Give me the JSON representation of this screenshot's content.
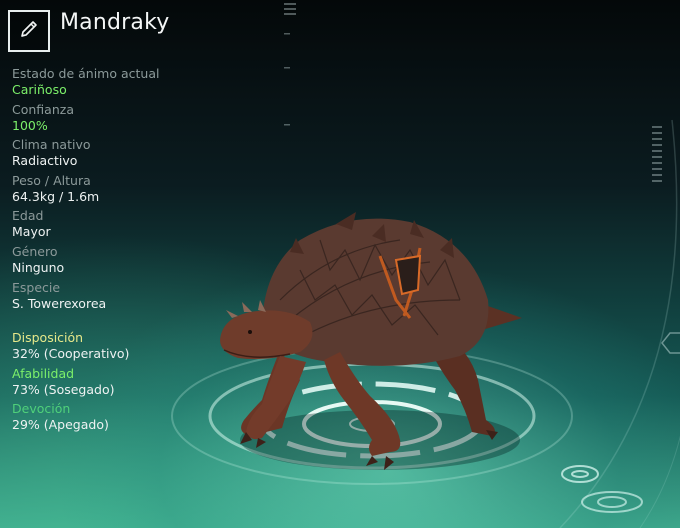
{
  "creature": {
    "name": "Mandraky"
  },
  "stats": [
    {
      "label": "Estado de ánimo actual",
      "value": "Cariñoso",
      "highlight": true
    },
    {
      "label": "Confianza",
      "value": "100%",
      "highlight": true
    },
    {
      "label": "Clima nativo",
      "value": "Radiactivo",
      "highlight": false
    },
    {
      "label": "Peso / Altura",
      "value": "64.3kg / 1.6m",
      "highlight": false
    },
    {
      "label": "Edad",
      "value": "Mayor",
      "highlight": false
    },
    {
      "label": "Género",
      "value": "Ninguno",
      "highlight": false
    },
    {
      "label": "Especie",
      "value": "S. Towerexorea",
      "highlight": false
    }
  ],
  "traits": [
    {
      "label": "Disposición",
      "value": "32% (Cooperativo)",
      "color": "#e6e88a"
    },
    {
      "label": "Afabilidad",
      "value": "73% (Sosegado)",
      "color": "#7cf06a"
    },
    {
      "label": "Devoción",
      "value": "29% (Apegado)",
      "color": "#4fd07a"
    }
  ],
  "icons": {
    "edit": "pencil-icon"
  }
}
